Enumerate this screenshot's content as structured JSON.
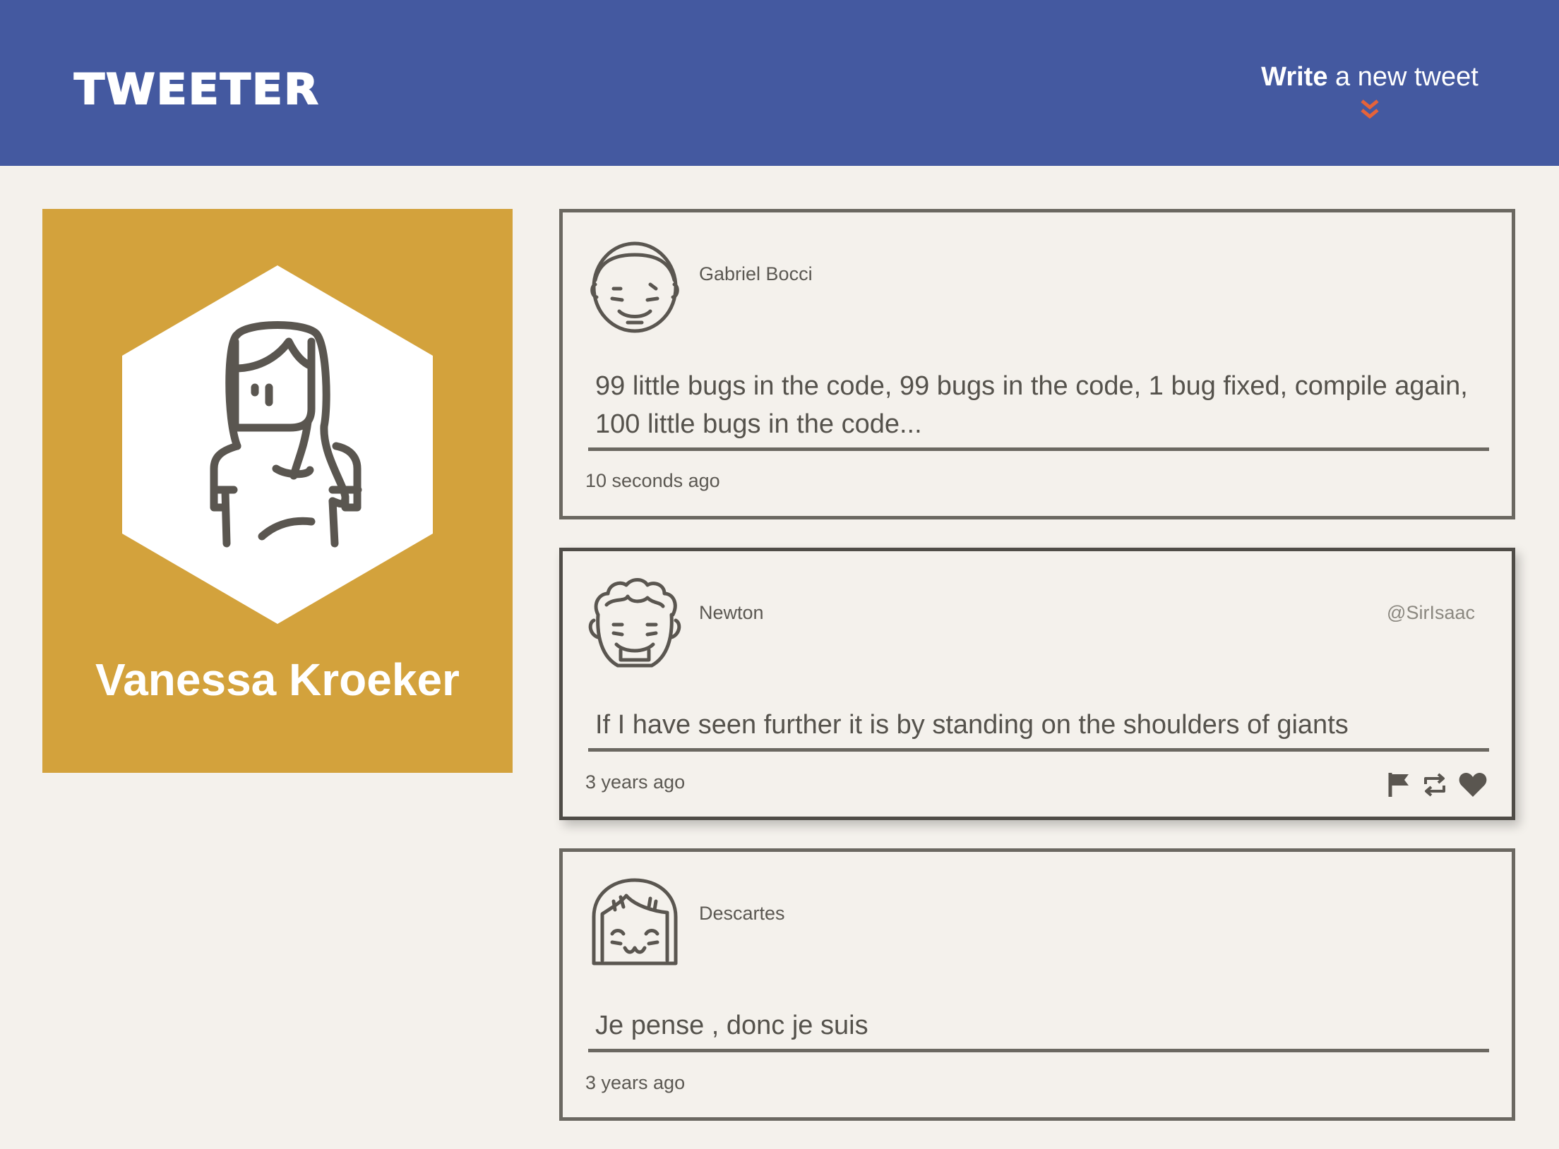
{
  "nav": {
    "brand": "TWEETER",
    "compose_strong": "Write",
    "compose_rest": " a new tweet",
    "compose_icon": "double-chevron-down-icon"
  },
  "profile": {
    "name": "Vanessa Kroeker",
    "avatar": "woman-avatar-icon"
  },
  "tweets": [
    {
      "name": "Gabriel Bocci",
      "handle": "",
      "content": "99 little bugs in the code, 99 bugs in the code, 1 bug fixed, compile again, 100 little bugs in the code...",
      "time": "10 seconds ago",
      "avatar": "smiling-man-avatar-icon"
    },
    {
      "name": "Newton",
      "handle": "@SirIsaac",
      "content": "If I have seen further it is by standing on the shoulders of giants",
      "time": "3 years ago",
      "avatar": "curly-hair-man-avatar-icon",
      "actions": [
        "flag-icon",
        "retweet-icon",
        "heart-icon"
      ]
    },
    {
      "name": "Descartes",
      "handle": "",
      "content": "Je pense , donc je suis",
      "time": "3 years ago",
      "avatar": "bob-hair-avatar-icon"
    }
  ],
  "colors": {
    "nav": "#4459a0",
    "accent": "#e5633a",
    "profile": "#d3a23c",
    "background": "#f4f1ec",
    "border": "#6b6861"
  }
}
